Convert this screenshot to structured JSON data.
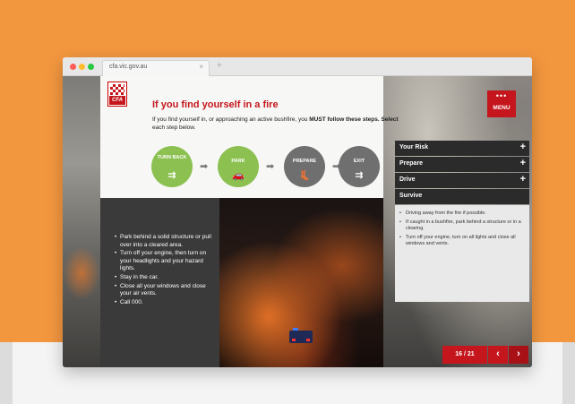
{
  "browser": {
    "tab_title": "cfa.vic.gov.au",
    "tab_close": "×",
    "new_tab": "+"
  },
  "logo": {
    "text": "CFA"
  },
  "page": {
    "title": "If you find yourself in a fire",
    "intro_a": "If you find yourself in, or approaching an active bushfire, you ",
    "intro_must": "MUST follow these steps.",
    "intro_b": " ",
    "intro_select": "Select",
    "intro_c": " each step below."
  },
  "steps": [
    {
      "label": "TURN BACK",
      "icon": "turn-back-icon",
      "glyph": "⇉"
    },
    {
      "label": "PARK",
      "icon": "car-icon",
      "glyph": "🚗"
    },
    {
      "label": "PREPARE",
      "icon": "boot-icon",
      "glyph": "👢"
    },
    {
      "label": "EXIT",
      "icon": "exit-icon",
      "glyph": "⇉"
    }
  ],
  "arrow_glyph": "➡",
  "park_bullets": [
    "Park behind a solid structure or pull over into a cleared area.",
    "Turn off your engine, then turn on your headlights and your hazard lights.",
    "Stay in the car.",
    "Close all your windows and close your air vents.",
    "Call 000."
  ],
  "menu": {
    "dots": "•••",
    "label": "MENU"
  },
  "accordion": {
    "items": [
      {
        "label": "Your Risk",
        "icon": "+"
      },
      {
        "label": "Prepare",
        "icon": "+"
      },
      {
        "label": "Drive",
        "icon": "+"
      },
      {
        "label": "Survive",
        "icon": ""
      }
    ],
    "survive_bullets": [
      "Driving away from the fire if possible.",
      "If caught in a bushfire, park behind a structure or in a clearing.",
      "Turn off your engine, turn on all lights and close all windows and vents."
    ]
  },
  "pager": {
    "text": "16 / 21",
    "prev": "‹",
    "next": "›"
  },
  "colors": {
    "brand_red": "#c4161c",
    "step_green": "#8cc152",
    "step_grey": "#6f6f6f",
    "page_bg": "#f3973f"
  }
}
